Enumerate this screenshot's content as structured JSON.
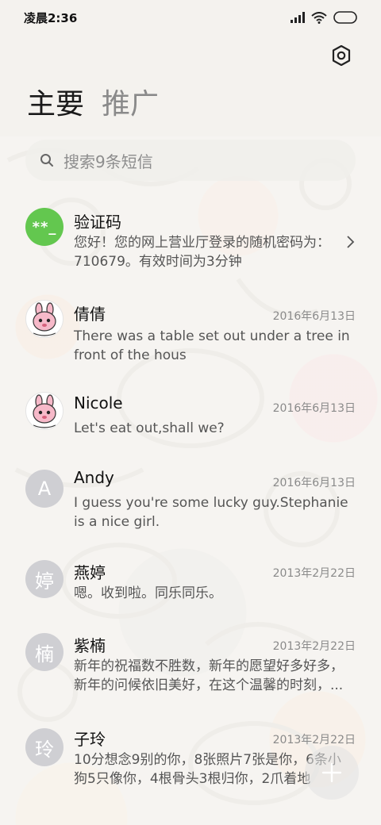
{
  "status_bar": {
    "time": "凌晨2:36",
    "icons": [
      "signal-icon",
      "wifi-icon",
      "battery-icon"
    ]
  },
  "header": {
    "settings_icon": "gear-icon",
    "tabs": [
      {
        "label": "主要",
        "active": true
      },
      {
        "label": "推广",
        "active": false
      }
    ]
  },
  "search": {
    "placeholder": "搜索9条短信"
  },
  "conversations": [
    {
      "avatar_type": "code",
      "avatar_text": "**_",
      "name": "验证码",
      "date": "",
      "preview": "您好！您的网上营业厅登录的随机密码为：710679。有效时间为3分钟",
      "has_chevron": true
    },
    {
      "avatar_type": "picture",
      "avatar_text": "",
      "name": "倩倩",
      "date": "2016年6月13日",
      "preview": "There was a table set out under a tree in front of the hous"
    },
    {
      "avatar_type": "picture",
      "avatar_text": "",
      "name": "Nicole",
      "date": "2016年6月13日",
      "preview": "Let's eat out,shall we?"
    },
    {
      "avatar_type": "letter",
      "avatar_text": "A",
      "name": "Andy",
      "date": "2016年6月13日",
      "preview": "I guess you're some lucky guy.Stephanie is a nice girl."
    },
    {
      "avatar_type": "letter",
      "avatar_text": "婷",
      "name": "燕婷",
      "date": "2013年2月22日",
      "preview": "嗯。收到啦。同乐同乐。"
    },
    {
      "avatar_type": "letter",
      "avatar_text": "楠",
      "name": "紫楠",
      "date": "2013年2月22日",
      "preview": "新年的祝福数不胜数，新年的愿望好多好多，新年的问候依旧美好，在这个温馨的时刻，..."
    },
    {
      "avatar_type": "letter",
      "avatar_text": "玲",
      "name": "子玲",
      "date": "2013年2月22日",
      "preview": "10分想念9别的你，8张照片7张是你，6条小狗5只像你，4根骨头3根归你，2爪着地"
    }
  ],
  "fab": {
    "icon": "plus-icon"
  },
  "colors": {
    "code_avatar": "#63c74f",
    "letter_avatar": "#cfcfd3"
  }
}
